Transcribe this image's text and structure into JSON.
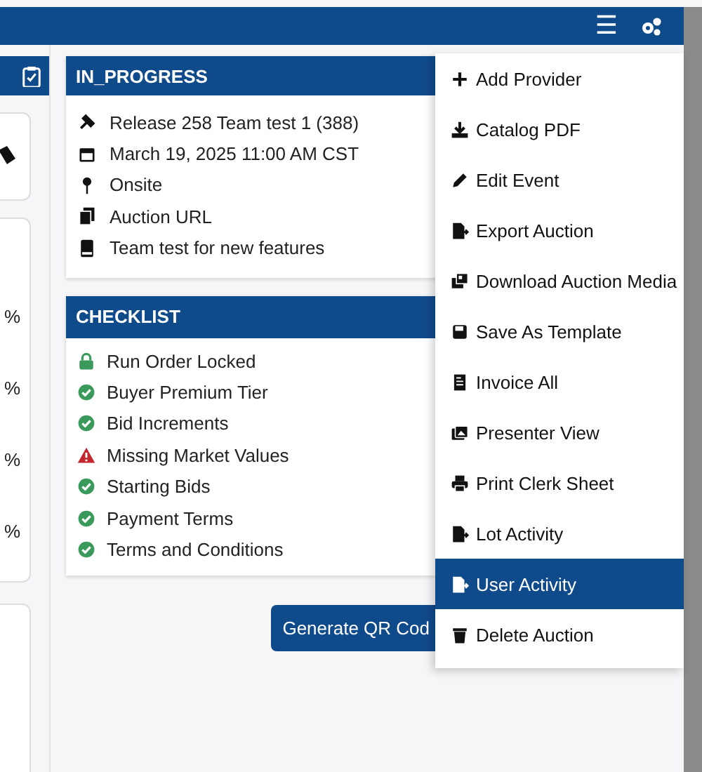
{
  "top_bar": {
    "menu_icon": "☰"
  },
  "left_panel": {
    "percent_labels": [
      "%",
      "%",
      "%",
      "%"
    ]
  },
  "status_card": {
    "title": "IN_PROGRESS",
    "rows": [
      {
        "text": "Release 258 Team test 1 (388)"
      },
      {
        "text": "March 19, 2025 11:00 AM CST"
      },
      {
        "text": "Onsite"
      },
      {
        "text": "Auction URL"
      },
      {
        "text": "Team test for new features"
      }
    ]
  },
  "checklist": {
    "title": "CHECKLIST",
    "items": [
      {
        "label": "Run Order Locked",
        "kind": "locked"
      },
      {
        "label": "Buyer Premium Tier",
        "kind": "done"
      },
      {
        "label": "Bid Increments",
        "kind": "done"
      },
      {
        "label": "Missing Market Values",
        "kind": "warning"
      },
      {
        "label": "Starting Bids",
        "kind": "done"
      },
      {
        "label": "Payment Terms",
        "kind": "done"
      },
      {
        "label": "Terms and Conditions",
        "kind": "done"
      }
    ]
  },
  "qr_button": {
    "label": "Generate QR Cod"
  },
  "actions_menu": {
    "items": [
      {
        "label": "Add Provider",
        "selected": false
      },
      {
        "label": "Catalog PDF",
        "selected": false
      },
      {
        "label": "Edit Event",
        "selected": false
      },
      {
        "label": "Export Auction",
        "selected": false
      },
      {
        "label": "Download Auction Media",
        "selected": false
      },
      {
        "label": "Save As Template",
        "selected": false
      },
      {
        "label": "Invoice All",
        "selected": false
      },
      {
        "label": "Presenter View",
        "selected": false
      },
      {
        "label": "Print Clerk Sheet",
        "selected": false
      },
      {
        "label": "Lot Activity",
        "selected": false
      },
      {
        "label": "User Activity",
        "selected": true
      },
      {
        "label": "Delete Auction",
        "selected": false
      }
    ]
  }
}
